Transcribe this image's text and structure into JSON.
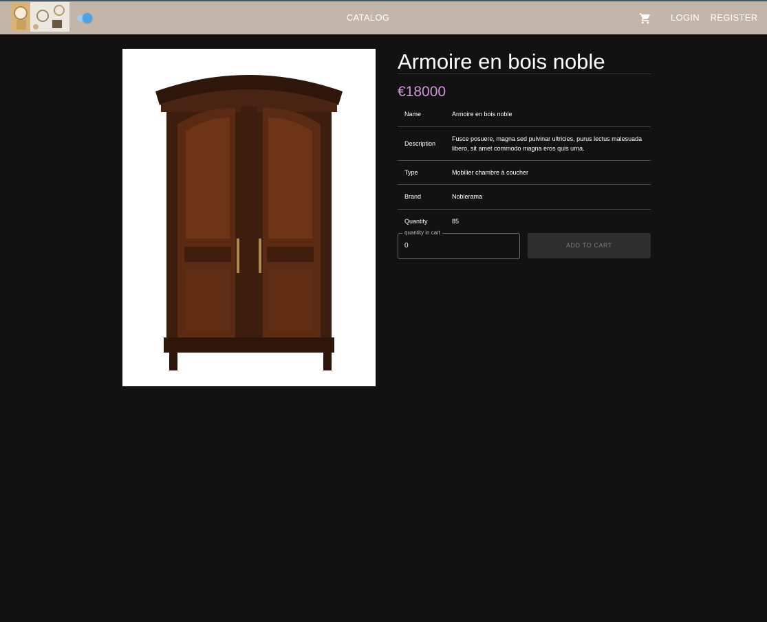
{
  "nav": {
    "catalog_label": "CATALOG",
    "login_label": "LOGIN",
    "register_label": "REGISTER",
    "cart_icon": "cart-icon",
    "theme_toggle_on": true
  },
  "product": {
    "title": "Armoire en bois noble",
    "price": "€18000",
    "specs": [
      {
        "label": "Name",
        "value": "Armoire en bois noble"
      },
      {
        "label": "Description",
        "value": "Fusce posuere, magna sed pulvinar ultricies, purus lectus malesuada libero, sit amet commodo magna eros quis urna."
      },
      {
        "label": "Type",
        "value": "Mobilier chambre à coucher"
      },
      {
        "label": "Brand",
        "value": "Noblerama"
      },
      {
        "label": "Quantity",
        "value": "85"
      }
    ],
    "quantity_label": "quantity in cart",
    "quantity_value": "0",
    "add_to_cart_label": "ADD TO CART"
  },
  "colors": {
    "topbar": "#c4b5aa",
    "background": "#121212",
    "price": "#ce93d8",
    "toggle": "#4aa3e8"
  }
}
